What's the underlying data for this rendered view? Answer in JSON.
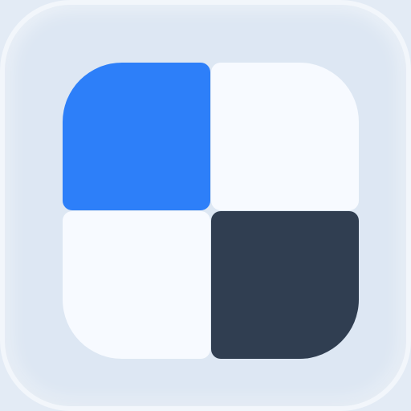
{
  "icon": {
    "name": "four-square-grid-app-icon",
    "colors": {
      "background": "#dde7f3",
      "border": "#f2f6fb",
      "tile_top_left": "#2d7ff9",
      "tile_top_right": "#f7faff",
      "tile_bottom_left": "#f7faff",
      "tile_bottom_right": "#303e51"
    }
  }
}
